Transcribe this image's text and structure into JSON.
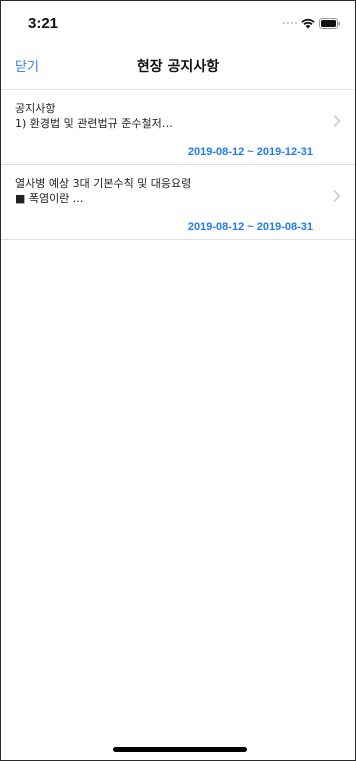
{
  "status_bar": {
    "time": "3:21"
  },
  "nav": {
    "close_label": "닫기",
    "title": "현장 공지사항"
  },
  "notices": [
    {
      "title": "공지사항",
      "preview": "1) 환경법 및 관련법규 준수철저…",
      "date": "2019-08-12 ~ 2019-12-31"
    },
    {
      "title": "열사병 예상 3대 기본수칙 및 대응요령",
      "preview": "■ 폭염이란 ...",
      "date": "2019-08-12 ~ 2019-08-31"
    }
  ],
  "colors": {
    "accent": "#2f7cf6",
    "date": "#1e7cf2",
    "divider": "#dedede"
  }
}
